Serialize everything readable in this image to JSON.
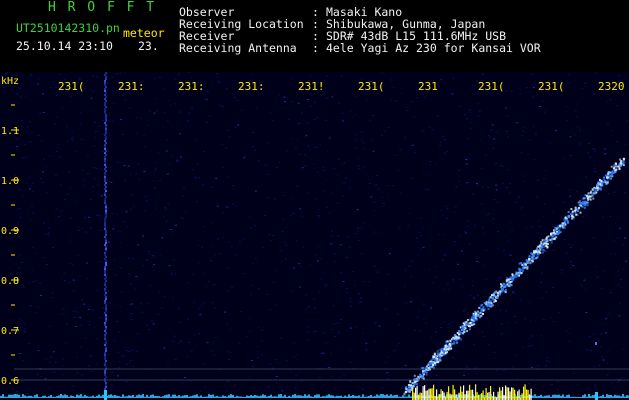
{
  "header": {
    "app_title": "H R O F F T",
    "filename": "UT2510142310.pn",
    "tag": "meteor",
    "datetime": "25.10.14 23:10",
    "value_23": "23.",
    "meta": [
      {
        "label": "Observer",
        "sep": ":",
        "value": "Masaki Kano"
      },
      {
        "label": "Receiving Location",
        "sep": ":",
        "value": "Shibukawa, Gunma, Japan"
      },
      {
        "label": "Receiver",
        "sep": ":",
        "value": "SDR# 43dB L15 111.6MHz USB"
      },
      {
        "label": "Receiving Antenna",
        "sep": ":",
        "value": "4ele Yagi Az 230 for Kansai VOR"
      }
    ]
  },
  "plot": {
    "y_unit": "kHz",
    "y_ticks": [
      "1.1",
      "1.0",
      "0.9",
      "0.8",
      "0.7",
      "0.6"
    ],
    "x_ticks": [
      "2311",
      "2312",
      "2313",
      "2314",
      "2315",
      "2316",
      "2317",
      "2318",
      "2319",
      "2320"
    ],
    "x_tick_partial": [
      "231(",
      "231:",
      "231:",
      "231:",
      "231!",
      "231(",
      "231",
      "231(",
      "231(",
      "2320"
    ],
    "colors": {
      "background": "#00001a",
      "noise": "#0a1a7a",
      "trace_core": "#d9f3ff",
      "trace_edge": "#2e7fff",
      "axis_text": "#ffea00",
      "baseline": "#2cc5ff",
      "signal_bars": "#fff200"
    }
  }
}
